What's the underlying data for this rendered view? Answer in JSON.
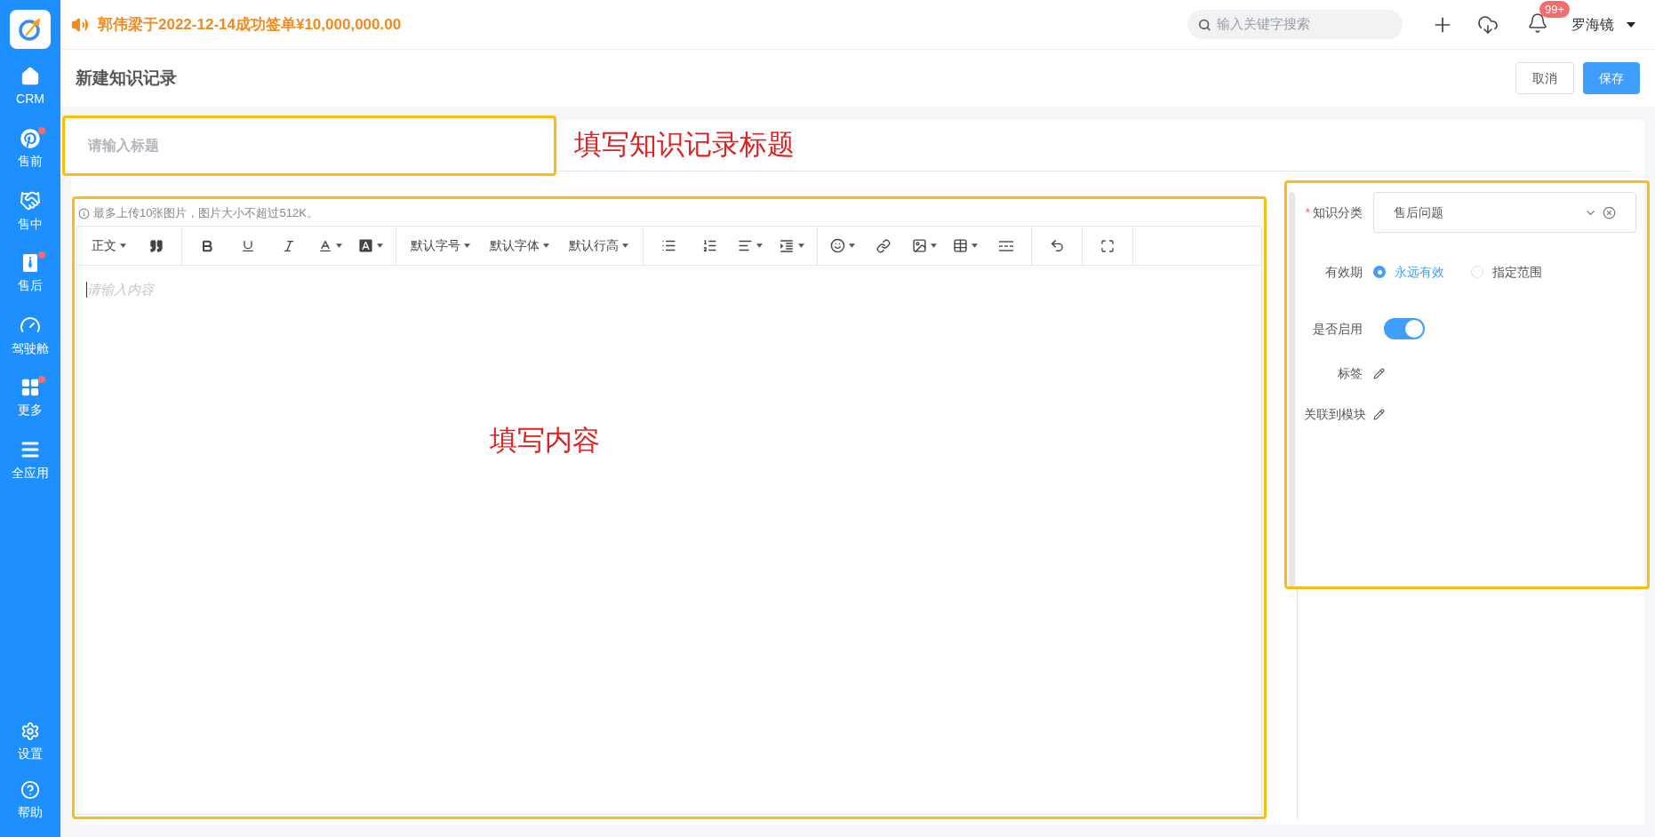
{
  "sidebar": {
    "items": [
      {
        "label": "CRM",
        "badge": false
      },
      {
        "label": "售前",
        "badge": true
      },
      {
        "label": "售中",
        "badge": false
      },
      {
        "label": "售后",
        "badge": true
      },
      {
        "label": "驾驶舱",
        "badge": false
      },
      {
        "label": "更多",
        "badge": true
      },
      {
        "label": "全应用",
        "badge": false
      }
    ],
    "bottom_items": [
      {
        "label": "设置"
      },
      {
        "label": "帮助"
      }
    ]
  },
  "top_bar": {
    "announcement": "郭伟梁于2022-12-14成功签单¥10,000,000.00",
    "search": {
      "placeholder": "输入关键字搜索"
    },
    "notification_badge": "99+",
    "user": "罗海镜"
  },
  "header": {
    "title": "新建知识记录",
    "buttons": [
      {
        "label": "取消",
        "kind": "default"
      },
      {
        "label": "保存",
        "kind": "primary"
      }
    ]
  },
  "title_field": {
    "placeholder": "请输入标题"
  },
  "annotations": {
    "title": "填写知识记录标题",
    "content": "填写内容"
  },
  "editor": {
    "hint": "最多上传10张图片，图片大小不超过512K。",
    "placeholder": "请输入内容",
    "toolbar": [
      [
        {
          "kind": "text",
          "label": "正文",
          "caret": true
        },
        {
          "kind": "icon",
          "caret": false
        }
      ],
      [
        {
          "kind": "icon",
          "caret": false
        },
        {
          "kind": "icon",
          "caret": false
        },
        {
          "kind": "icon",
          "caret": false
        },
        {
          "kind": "icon",
          "caret": true
        },
        {
          "kind": "icon",
          "caret": true
        }
      ],
      [
        {
          "kind": "text",
          "label": "默认字号",
          "caret": true
        },
        {
          "kind": "text",
          "label": "默认字体",
          "caret": true
        },
        {
          "kind": "text",
          "label": "默认行高",
          "caret": true
        }
      ],
      [
        {
          "kind": "icon",
          "caret": false
        },
        {
          "kind": "icon",
          "caret": false
        },
        {
          "kind": "icon",
          "caret": true
        },
        {
          "kind": "icon",
          "caret": true
        }
      ],
      [
        {
          "kind": "icon",
          "caret": true
        },
        {
          "kind": "icon",
          "caret": false
        },
        {
          "kind": "icon",
          "caret": true
        },
        {
          "kind": "icon",
          "caret": true
        },
        {
          "kind": "icon",
          "caret": false
        }
      ],
      [
        {
          "kind": "icon",
          "caret": false
        }
      ],
      [
        {
          "kind": "icon",
          "caret": false
        }
      ]
    ]
  },
  "side_form": {
    "category": {
      "label": "知识分类",
      "required_mark": "*",
      "value": "售后问题"
    },
    "validity": {
      "label": "有效期",
      "options": [
        {
          "label": "永远有效",
          "selected": true
        },
        {
          "label": "指定范围",
          "selected": false
        }
      ]
    },
    "enabled": {
      "label": "是否启用",
      "on": true
    },
    "tags": {
      "label": "标签"
    },
    "module": {
      "label": "关联到模块"
    }
  }
}
